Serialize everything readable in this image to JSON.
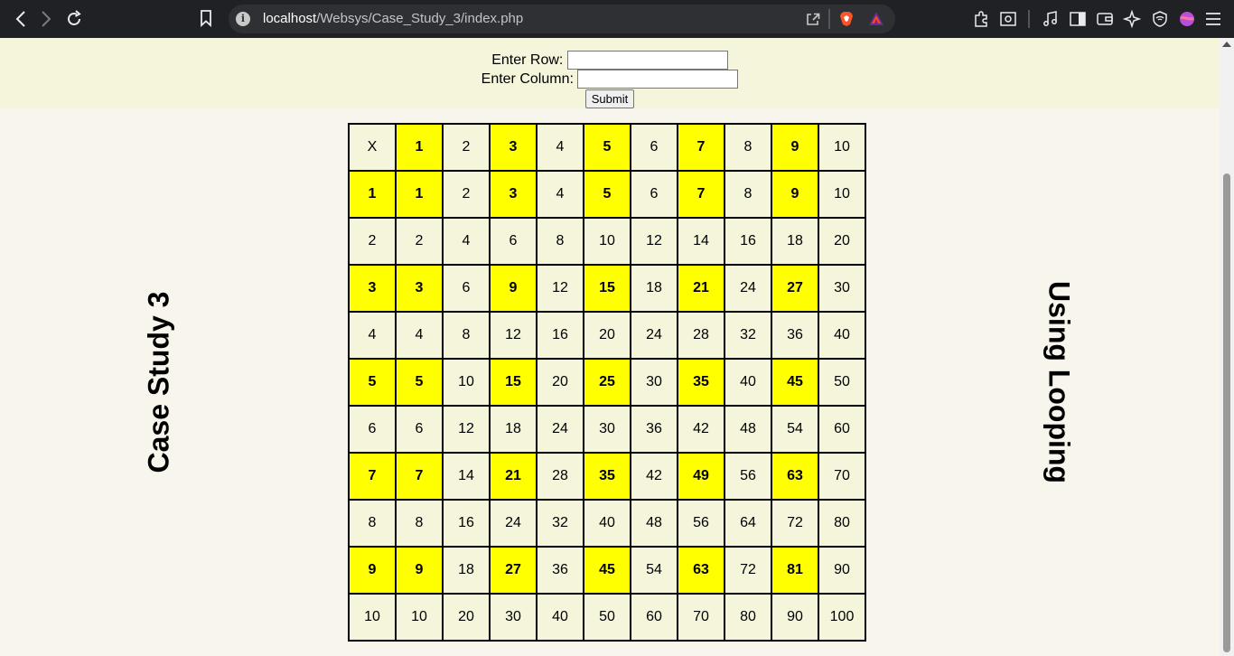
{
  "browser": {
    "url_host": "localhost",
    "url_path": "/Websys/Case_Study_3/index.php",
    "icons": [
      "back-icon",
      "forward-icon",
      "reload-icon",
      "bookmark-icon",
      "info-icon",
      "share-icon",
      "brave-shields-icon",
      "brave-rewards-icon",
      "extensions-icon",
      "screenshot-icon",
      "media-icon",
      "sidebar-icon",
      "wallet-icon",
      "leo-ai-icon",
      "vpn-icon",
      "profile-icon",
      "menu-icon"
    ]
  },
  "form": {
    "row_label": "Enter Row:",
    "row_value": "",
    "column_label": "Enter Column:",
    "column_value": "",
    "submit_label": "Submit"
  },
  "left_title": "Case Study 3",
  "right_title": "Using Looping",
  "colors": {
    "highlight": "#ffff00",
    "cell": "#f5f5dc",
    "form_bg": "#f5f5dc",
    "page_bg": "#f8f6ec"
  },
  "table": {
    "corner": "X",
    "rows": [
      [
        "X",
        "1",
        "2",
        "3",
        "4",
        "5",
        "6",
        "7",
        "8",
        "9",
        "10"
      ],
      [
        "1",
        "1",
        "2",
        "3",
        "4",
        "5",
        "6",
        "7",
        "8",
        "9",
        "10"
      ],
      [
        "2",
        "2",
        "4",
        "6",
        "8",
        "10",
        "12",
        "14",
        "16",
        "18",
        "20"
      ],
      [
        "3",
        "3",
        "6",
        "9",
        "12",
        "15",
        "18",
        "21",
        "24",
        "27",
        "30"
      ],
      [
        "4",
        "4",
        "8",
        "12",
        "16",
        "20",
        "24",
        "28",
        "32",
        "36",
        "40"
      ],
      [
        "5",
        "5",
        "10",
        "15",
        "20",
        "25",
        "30",
        "35",
        "40",
        "45",
        "50"
      ],
      [
        "6",
        "6",
        "12",
        "18",
        "24",
        "30",
        "36",
        "42",
        "48",
        "54",
        "60"
      ],
      [
        "7",
        "7",
        "14",
        "21",
        "28",
        "35",
        "42",
        "49",
        "56",
        "63",
        "70"
      ],
      [
        "8",
        "8",
        "16",
        "24",
        "32",
        "40",
        "48",
        "56",
        "64",
        "72",
        "80"
      ],
      [
        "9",
        "9",
        "18",
        "27",
        "36",
        "45",
        "54",
        "63",
        "72",
        "81",
        "90"
      ],
      [
        "10",
        "10",
        "20",
        "30",
        "40",
        "50",
        "60",
        "70",
        "80",
        "90",
        "100"
      ]
    ]
  }
}
